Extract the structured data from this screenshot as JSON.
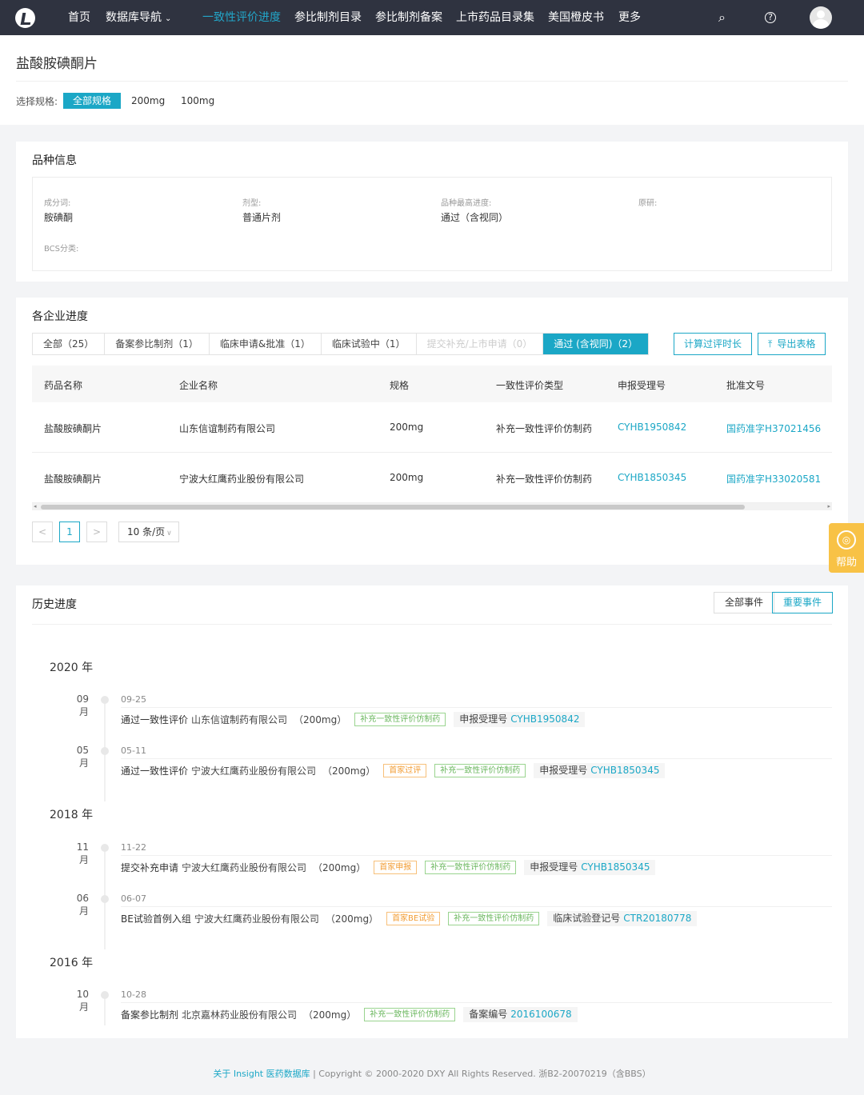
{
  "nav": {
    "items": [
      "首页",
      "数据库导航",
      "一致性评价进度",
      "参比制剂目录",
      "参比制剂备案",
      "上市药品目录集",
      "美国橙皮书",
      "更多"
    ],
    "dropdown_caret": "⌄",
    "search_icon": "⌕",
    "help_icon": "?",
    "accent_color": "#22a6c9"
  },
  "page": {
    "title": "盐酸胺碘酮片",
    "spec_label": "选择规格:",
    "spec_options": [
      "全部规格",
      "200mg",
      "100mg"
    ]
  },
  "variety": {
    "title": "品种信息",
    "fields": [
      {
        "label": "成分词:",
        "value": "胺碘酮"
      },
      {
        "label": "剂型:",
        "value": "普通片剂"
      },
      {
        "label": "品种最高进度:",
        "value": "通过（含视同）"
      },
      {
        "label": "原研:",
        "value": ""
      },
      {
        "label": "BCS分类:",
        "value": ""
      }
    ]
  },
  "progress": {
    "title": "各企业进度",
    "tabs": [
      "全部（25）",
      "备案参比制剂（1）",
      "临床申请&批准（1）",
      "临床试验中（1）",
      "提交补充/上市申请（0）",
      "通过 (含视同)（2）"
    ],
    "calc_button": "计算过评时长",
    "export_button": "导出表格",
    "export_icon": "⤒",
    "columns": [
      "药品名称",
      "企业名称",
      "规格",
      "一致性评价类型",
      "申报受理号",
      "批准文号"
    ],
    "rows": [
      [
        "盐酸胺碘酮片",
        "山东信谊制药有限公司",
        "200mg",
        "补充一致性评价仿制药",
        "CYHB1950842",
        "国药准字H37021456"
      ],
      [
        "盐酸胺碘酮片",
        "宁波大红鹰药业股份有限公司",
        "200mg",
        "补充一致性评价仿制药",
        "CYHB1850345",
        "国药准字H33020581"
      ]
    ],
    "pager": {
      "prev": "<",
      "current": "1",
      "next": ">",
      "page_size": "10 条/页",
      "size_arrow": "∨"
    }
  },
  "help": {
    "label": "帮助",
    "icon": "◎"
  },
  "history": {
    "title": "历史进度",
    "filters": [
      "全部事件",
      "重要事件"
    ],
    "years": [
      "2020 年",
      "2018 年",
      "2016 年"
    ],
    "events": [
      {
        "month": "09 月",
        "date": "09-25",
        "action": "通过一致性评价",
        "company": "山东信谊制药有限公司",
        "spec": "（200mg）",
        "tags": [
          {
            "text": "补充一致性评价仿制药",
            "color": "green"
          }
        ],
        "ref_label": "申报受理号",
        "ref": "CYHB1950842"
      },
      {
        "month": "05 月",
        "date": "05-11",
        "action": "通过一致性评价",
        "company": "宁波大红鹰药业股份有限公司",
        "spec": "（200mg）",
        "tags": [
          {
            "text": "首家过评",
            "color": "orange"
          },
          {
            "text": "补充一致性评价仿制药",
            "color": "green"
          }
        ],
        "ref_label": "申报受理号",
        "ref": "CYHB1850345"
      },
      {
        "month": "11 月",
        "date": "11-22",
        "action": "提交补充申请",
        "company": "宁波大红鹰药业股份有限公司",
        "spec": "（200mg）",
        "tags": [
          {
            "text": "首家申报",
            "color": "orange"
          },
          {
            "text": "补充一致性评价仿制药",
            "color": "green"
          }
        ],
        "ref_label": "申报受理号",
        "ref": "CYHB1850345"
      },
      {
        "month": "06 月",
        "date": "06-07",
        "action": "BE试验首例入组",
        "company": "宁波大红鹰药业股份有限公司",
        "spec": "（200mg）",
        "tags": [
          {
            "text": "首家BE试验",
            "color": "orange"
          },
          {
            "text": "补充一致性评价仿制药",
            "color": "green"
          }
        ],
        "ref_label": "临床试验登记号",
        "ref": "CTR20180778"
      },
      {
        "month": "10 月",
        "date": "10-28",
        "action": "备案参比制剂",
        "company": "北京嘉林药业股份有限公司",
        "spec": "（200mg）",
        "tags": [
          {
            "text": "补充一致性评价仿制药",
            "color": "green"
          }
        ],
        "ref_label": "备案编号",
        "ref": "2016100678"
      }
    ]
  },
  "footer": {
    "link": "关于 Insight 医药数据库",
    "text": " | Copyright © 2000-2020 DXY All Rights Reserved. 浙B2-20070219（含BBS）"
  }
}
